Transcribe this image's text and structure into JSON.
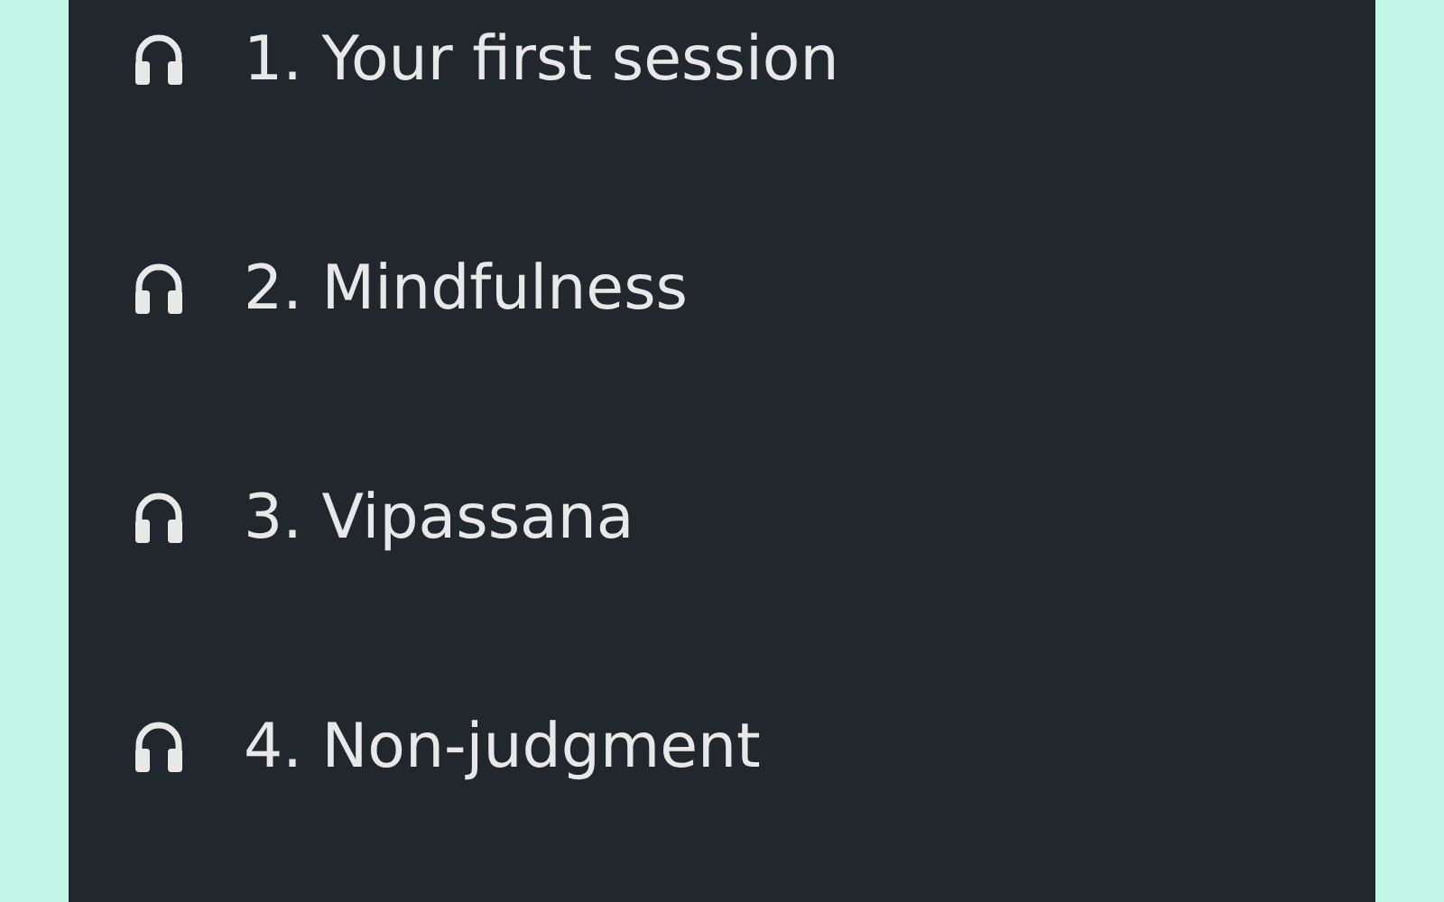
{
  "sessions": [
    {
      "title": "1. Your first session"
    },
    {
      "title": "2. Mindfulness"
    },
    {
      "title": "3. Vipassana"
    },
    {
      "title": "4. Non-judgment"
    }
  ]
}
